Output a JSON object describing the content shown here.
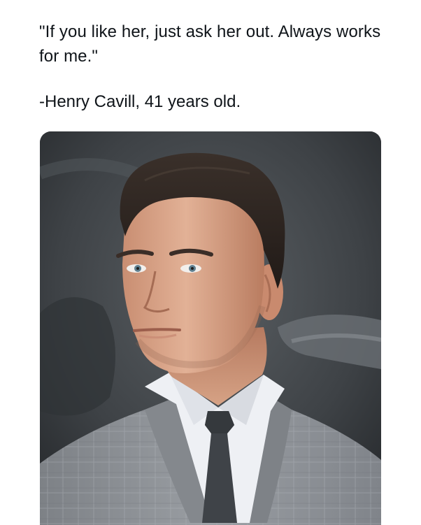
{
  "post": {
    "quote": "\"If you like her, just ask her out. Always works for me.\"",
    "attribution": "-Henry Cavill, 41 years old."
  },
  "media": {
    "alt": "photo-portrait",
    "colors": {
      "background": "#3c4044",
      "suit": "#8f9398",
      "shirt": "#eef0f4",
      "tie": "#3f4348",
      "skin": "#d9a688",
      "hair": "#2d2521"
    }
  }
}
